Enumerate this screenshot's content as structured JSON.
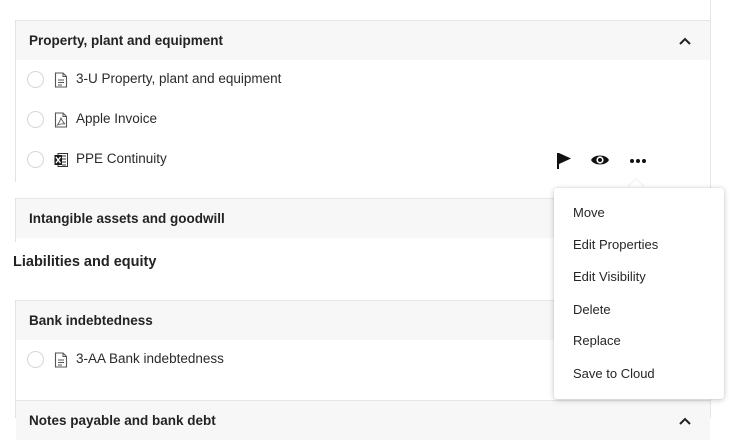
{
  "sections": {
    "ppe": {
      "title": "Property, plant and equipment"
    },
    "intangible": {
      "title": "Intangible assets and goodwill"
    },
    "bank": {
      "title": "Bank indebtedness"
    },
    "notes": {
      "title": "Notes payable and bank debt"
    }
  },
  "groups": {
    "liabilities": {
      "title": "Liabilities and equity"
    }
  },
  "rows": [
    {
      "label": "3-U Property, plant and equipment",
      "icon": "document-icon"
    },
    {
      "label": "Apple Invoice",
      "icon": "pdf-icon"
    },
    {
      "label": "PPE Continuity",
      "icon": "excel-icon"
    },
    {
      "label": "3-AA Bank indebtedness",
      "icon": "document-icon"
    }
  ],
  "row_actions": [
    "flag-icon",
    "eye-icon",
    "more-icon"
  ],
  "context_menu": {
    "items": [
      "Move",
      "Edit Properties",
      "Edit Visibility",
      "Delete",
      "Replace",
      "Save to Cloud"
    ]
  }
}
